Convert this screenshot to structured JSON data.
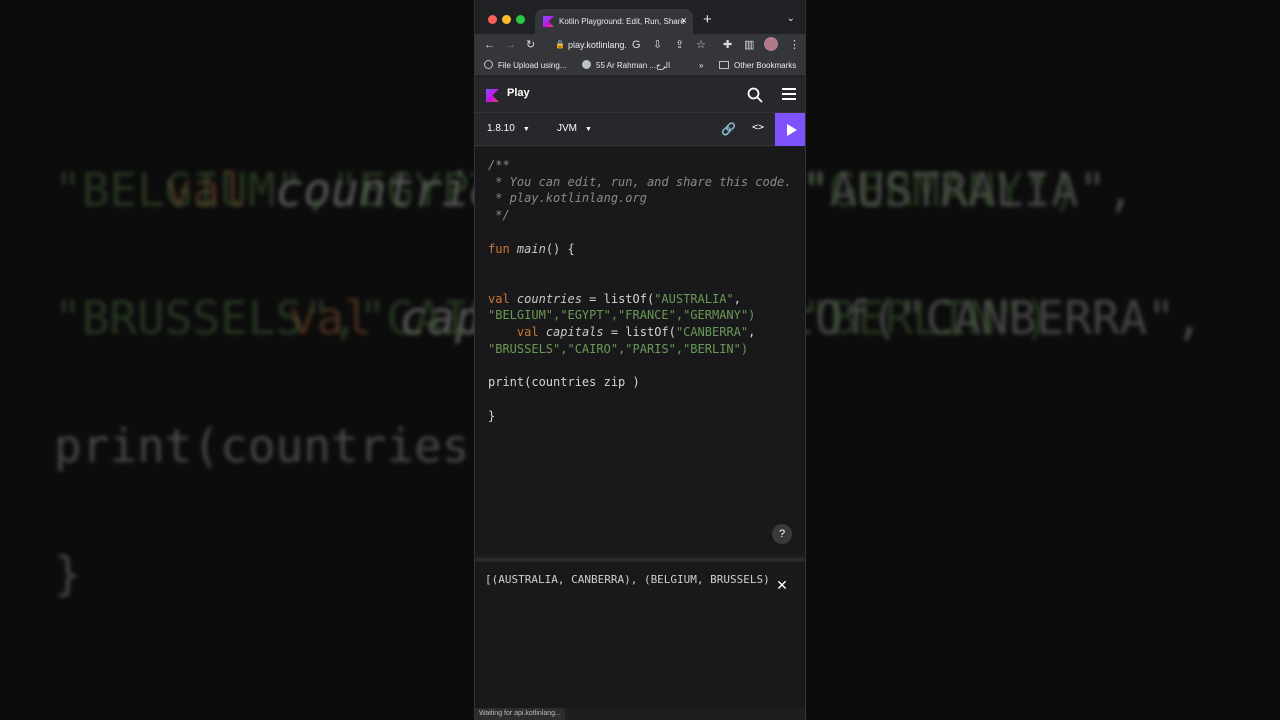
{
  "background": {
    "line1_kw": "val",
    "line1_id": "countries",
    "line1_rest": " = listOf(\"AUSTRALIA\",",
    "line2": "\"BELGIUM\",\"EGYPT\",\"FRANCE\",\"GERMANY\")",
    "line3_kw": "val",
    "line3_id": "capitals",
    "line3_rest": " = listOf(\"CANBERRA\",",
    "line4": "\"BRUSSELS\",\"CAIRO\",\"PARIS\",\"BERLIN\")",
    "line5": "print(countries zip )",
    "line6": "}"
  },
  "browser": {
    "tab_title": "Kotlin Playground: Edit, Run, Share",
    "address": "play.kotlinlang.org",
    "bookmarks": [
      {
        "label": "File Upload using..."
      },
      {
        "label": "55 Ar Rahman ...الرح"
      }
    ],
    "bookmarks_overflow": "»",
    "other_bookmarks": "Other Bookmarks"
  },
  "playground": {
    "title": "Play",
    "version": "1.8.10",
    "target": "JVM"
  },
  "editor": {
    "c1": "/**",
    "c2": " * You can edit, run, and share this code.",
    "c3": " * play.kotlinlang.org",
    "c4": " */",
    "fun_kw": "fun",
    "fun_name": "main",
    "fun_rest": "() {",
    "val1_kw": "val",
    "val1_id": "countries",
    "val1_rest": " = listOf(",
    "s_australia": "\"AUSTRALIA\"",
    "val1_line2": "\"BELGIUM\",\"EGYPT\",\"FRANCE\",\"GERMANY\")",
    "val2_kw": "val",
    "val2_id": "capitals",
    "val2_rest": " = listOf(",
    "s_canberra": "\"CANBERRA\"",
    "val2_line2": "\"BRUSSELS\",\"CAIRO\",\"PARIS\",\"BERLIN\")",
    "print_line": "print(countries zip )",
    "close_brace": "}"
  },
  "output": {
    "text": "[(AUSTRALIA, CANBERRA), (BELGIUM, BRUSSELS),"
  },
  "status": "Waiting for api.kotlinlang..."
}
